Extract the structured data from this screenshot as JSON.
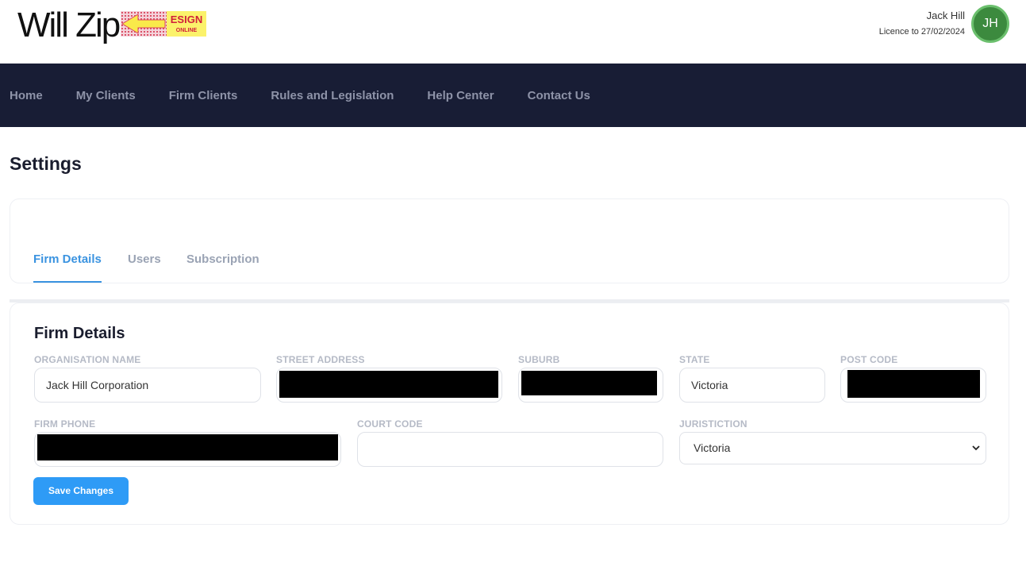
{
  "header": {
    "logo_text": "Will Zip",
    "esign_badge_top": "ESIGN",
    "esign_badge_bottom": "ONLINE",
    "user_name": "Jack Hill",
    "licence": "Licence to 27/02/2024",
    "avatar_initials": "JH"
  },
  "nav": {
    "items": [
      "Home",
      "My Clients",
      "Firm Clients",
      "Rules and Legislation",
      "Help Center",
      "Contact Us"
    ]
  },
  "page": {
    "title": "Settings"
  },
  "tabs": {
    "items": [
      "Firm Details",
      "Users",
      "Subscription"
    ],
    "active": "Firm Details"
  },
  "form": {
    "section_title": "Firm Details",
    "fields": {
      "organisation_name": {
        "label": "ORGANISATION NAME",
        "value": "Jack Hill Corporation"
      },
      "street_address": {
        "label": "STREET ADDRESS",
        "value": ""
      },
      "suburb": {
        "label": "SUBURB",
        "value": ""
      },
      "state": {
        "label": "STATE",
        "value": "Victoria"
      },
      "post_code": {
        "label": "POST CODE",
        "value": ""
      },
      "firm_phone": {
        "label": "FIRM PHONE",
        "value": ""
      },
      "court_code": {
        "label": "COURT CODE",
        "value": ""
      },
      "juristiction": {
        "label": "JURISTICTION",
        "value": "Victoria"
      }
    },
    "save_label": "Save Changes"
  },
  "colors": {
    "nav_bg": "#181d35",
    "accent": "#3a93e0",
    "button": "#2e9bf6",
    "avatar": "#3c8a3e"
  }
}
